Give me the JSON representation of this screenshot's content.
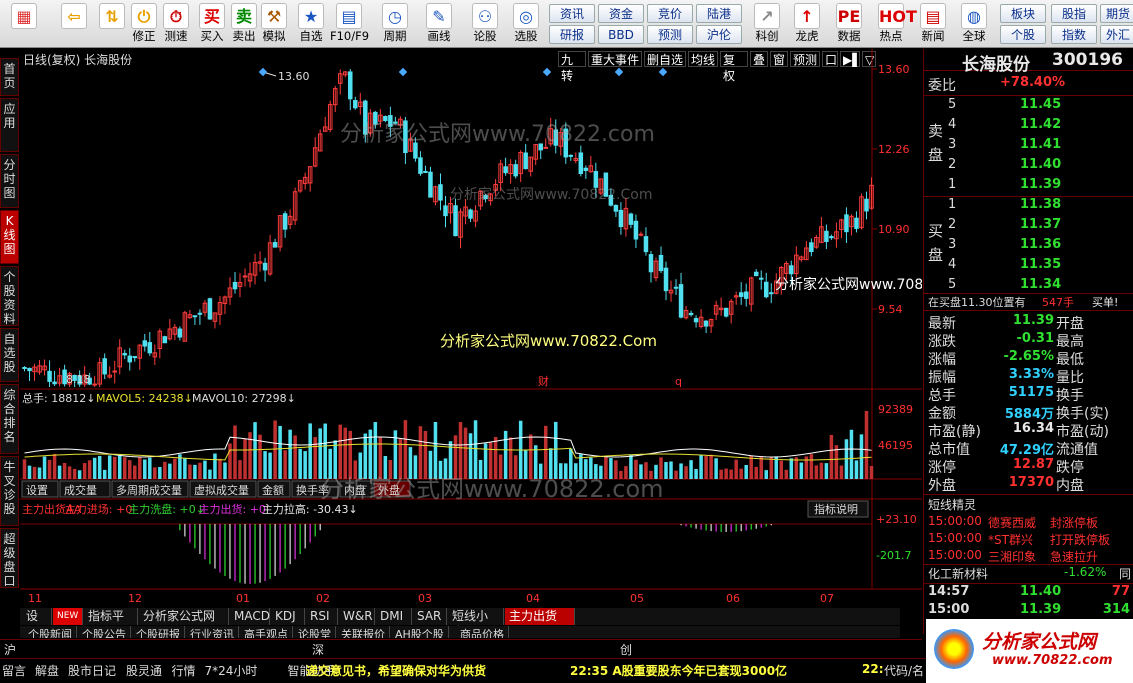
{
  "toolbar": {
    "buttons": [
      {
        "label": "",
        "icon": "▦",
        "color": "#d33",
        "name": "logo-grid-icon"
      },
      {
        "label": "",
        "icon": "⇦",
        "color": "#e8a000",
        "name": "back-arrow-icon"
      },
      {
        "label": "",
        "icon": "⇅",
        "color": "#e8a000",
        "name": "up-down-arrows-icon"
      },
      {
        "label": "修正",
        "icon": "⏻",
        "color": "#e8a000",
        "name": "power-icon"
      },
      {
        "label": "测速",
        "icon": "⏱",
        "color": "#c00",
        "name": "clock-icon"
      },
      {
        "label": "买入",
        "icon": "买",
        "color": "#d00",
        "name": "buy-icon"
      },
      {
        "label": "卖出",
        "icon": "卖",
        "color": "#080",
        "name": "sell-icon"
      },
      {
        "label": "模拟",
        "icon": "⚒",
        "color": "#a50",
        "name": "hammer-icon"
      },
      {
        "label": "自选",
        "icon": "★",
        "color": "#1a55c0",
        "name": "star-icon"
      },
      {
        "label": "F10/F9",
        "icon": "▤",
        "color": "#1a55c0",
        "name": "f10-icon"
      },
      {
        "label": "周期",
        "icon": "◷",
        "color": "#1a55c0",
        "name": "period-icon"
      },
      {
        "label": "画线",
        "icon": "✎",
        "color": "#1a55c0",
        "name": "draw-line-icon"
      },
      {
        "label": "论股",
        "icon": "⚇",
        "color": "#1a55c0",
        "name": "discuss-icon"
      },
      {
        "label": "选股",
        "icon": "◎",
        "color": "#1a55c0",
        "name": "select-stock-icon"
      },
      {
        "label": "",
        "icon": "",
        "color": "#000",
        "name": "spacer"
      },
      {
        "label": "科创",
        "icon": "↗",
        "color": "#888",
        "name": "kechuang-icon"
      },
      {
        "label": "龙虎",
        "icon": "↑",
        "color": "#d00",
        "name": "longhu-icon"
      },
      {
        "label": "数据",
        "icon": "PE",
        "color": "#c00",
        "name": "data-pe-icon"
      },
      {
        "label": "热点",
        "icon": "HOT",
        "color": "#d00",
        "name": "hot-icon"
      },
      {
        "label": "新闻",
        "icon": "▤",
        "color": "#c00",
        "name": "news-icon"
      },
      {
        "label": "全球",
        "icon": "◍",
        "color": "#1a55c0",
        "name": "globe-icon"
      }
    ],
    "grid_buttons": [
      [
        "资讯",
        "资金",
        "竞价",
        "陆港"
      ],
      [
        "研报",
        "BBD",
        "预测",
        "沪伦"
      ]
    ],
    "right_buttons": [
      [
        "板块",
        "股指",
        "期货"
      ],
      [
        "个股",
        "指数",
        "外汇"
      ]
    ]
  },
  "left_tabs": [
    "首页",
    "应用",
    "分时图",
    "K线图",
    "个股资料",
    "自选股",
    "综合排名",
    "牛叉诊股",
    "超级盘口"
  ],
  "chart": {
    "title": "日线(复权)  长海股份",
    "right_buttons": [
      "九转",
      "重大事件",
      "删自选",
      "均线",
      "复权",
      "叠",
      "窗",
      "预测",
      "口",
      "▶▌",
      "▽"
    ],
    "price_high_label": "13.60",
    "price_low_label": "8.18",
    "price_axis": [
      "13.60",
      "12.26",
      "10.90",
      "9.54"
    ],
    "markers": [
      "财",
      "q"
    ],
    "vol_header": {
      "a": "总手: 18812↓",
      "b": "MAVOL5: 24238↓",
      "c": "MAVOL10: 27298↓"
    },
    "vol_axis": [
      "92389",
      "46195"
    ],
    "vol_tabs": [
      "设置",
      "成交量",
      "多周期成交量",
      "虚拟成交量",
      "金额",
      "换手率",
      "内盘",
      "外盘"
    ],
    "ind_header": [
      {
        "t": "主力出货AA",
        "c": "#ff3030"
      },
      {
        "t": " 主力进场: +0",
        "c": "#ff3030"
      },
      {
        "t": " 主力洗盘: +0↓",
        "c": "#30d030"
      },
      {
        "t": " 主力出货: +0",
        "c": "#e030e0"
      },
      {
        "t": " 主力拉高: -30.43↓",
        "c": "#e8e8e8"
      }
    ],
    "ind_axis": [
      "+23.10",
      "-201.7"
    ],
    "ind_btn": "指标说明",
    "months": [
      "11",
      "12",
      "01",
      "02",
      "03",
      "04",
      "05",
      "06",
      "07"
    ],
    "bottom_tabs": [
      "设置",
      "NEW",
      "指标平台",
      "分析家公式网",
      "MACD",
      "KDJ",
      "RSI",
      "W&R",
      "DMI",
      "SAR",
      "短线小牛",
      "主力出货AA"
    ],
    "bottom_tabs2": [
      "个股新闻",
      "个股公告",
      "个股研报",
      "行业资讯",
      "高手观点",
      "论股堂",
      "关联报价",
      "AH股个股",
      "商品价格"
    ],
    "watermarks": [
      "分析家公式网www.70822.com",
      "分析家公式网www.70822.Com",
      "分析家公式网www.70822.Com",
      "分析家公式网www.70822.com",
      "分析家公式网www.70822.com"
    ]
  },
  "chart_data": {
    "type": "candlestick",
    "x_range": [
      "11",
      "07"
    ],
    "price_ylim": [
      8.18,
      13.6
    ],
    "volume_ylim": [
      0,
      92389
    ],
    "high": 13.6,
    "low": 8.18
  },
  "right": {
    "stock_name": "长海股份",
    "stock_code": "300196",
    "weibi_label": "委比",
    "weibi_value": "+78.40%",
    "sell_label": "卖盘",
    "buy_label": "买盘",
    "asks": [
      {
        "n": "5",
        "p": "11.45"
      },
      {
        "n": "4",
        "p": "11.42"
      },
      {
        "n": "3",
        "p": "11.41"
      },
      {
        "n": "2",
        "p": "11.40"
      },
      {
        "n": "1",
        "p": "11.39"
      }
    ],
    "bids": [
      {
        "n": "1",
        "p": "11.38"
      },
      {
        "n": "2",
        "p": "11.37"
      },
      {
        "n": "3",
        "p": "11.36"
      },
      {
        "n": "4",
        "p": "11.35"
      },
      {
        "n": "5",
        "p": "11.34"
      }
    ],
    "info_line": {
      "a": "在买盘11.30位置有",
      "b": "547手",
      "c": "买单!"
    },
    "stats": [
      {
        "k": "最新",
        "v": "11.39",
        "c": "#30e030",
        "k2": "开盘"
      },
      {
        "k": "涨跌",
        "v": "-0.31",
        "c": "#30e030",
        "k2": "最高"
      },
      {
        "k": "涨幅",
        "v": "-2.65%",
        "c": "#30e030",
        "k2": "最低"
      },
      {
        "k": "振幅",
        "v": "3.33%",
        "c": "#30d0ff",
        "k2": "量比"
      },
      {
        "k": "总手",
        "v": "51175",
        "c": "#30d0ff",
        "k2": "换手"
      },
      {
        "k": "金额",
        "v": "5884万",
        "c": "#30d0ff",
        "k2": "换手(实)"
      },
      {
        "k": "市盈(静)",
        "v": "16.34",
        "c": "#e8e8e8",
        "k2": "市盈(动)"
      },
      {
        "k": "总市值",
        "v": "47.29亿",
        "c": "#30d0ff",
        "k2": "流通值"
      },
      {
        "k": "涨停",
        "v": "12.87",
        "c": "#ff3030",
        "k2": "跌停"
      },
      {
        "k": "外盘",
        "v": "17370",
        "c": "#ff3030",
        "k2": "内盘"
      }
    ],
    "short_title": "短线精灵",
    "short_rows": [
      {
        "t": "15:00:00",
        "s": "德赛西威",
        "e": "封涨停板"
      },
      {
        "t": "15:00:00",
        "s": "*ST群兴",
        "e": "打开跌停板"
      },
      {
        "t": "15:00:00",
        "s": "三湘印象",
        "e": "急速拉升"
      }
    ],
    "sector": {
      "name": "化工新材料",
      "pct": "-1.62%",
      "extra": "同"
    },
    "ticks": [
      {
        "t": "14:57",
        "p": "11.40",
        "v": "77"
      },
      {
        "t": "15:00",
        "p": "11.39",
        "v": "314"
      }
    ]
  },
  "status": {
    "idx": [
      "沪",
      "深",
      "创"
    ],
    "items": [
      "留言",
      "解盘",
      "股市日记",
      "股灵通",
      "行情",
      "7*24小时",
      "智能助手"
    ],
    "news1": "递交意见书，希望确保对华为供货",
    "news2": "22:35 A股重要股东今年已套现3000亿",
    "news3": "22:",
    "search": "代码/名",
    "logo": "分析家公式网",
    "logo_url": "www.70822.com"
  }
}
